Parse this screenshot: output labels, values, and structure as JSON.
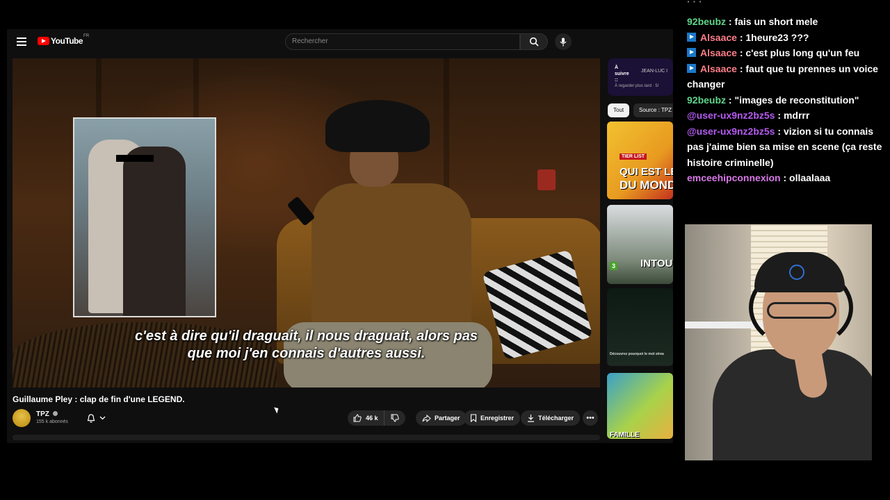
{
  "youtube": {
    "logo_text": "YouTube",
    "logo_region": "FR",
    "search_placeholder": "Rechercher",
    "video": {
      "subtitle": "c'est à dire qu'il draguait, il nous draguait, alors pas\nque moi j'en connais d'autres aussi."
    },
    "title": "Guillaume Pley : clap de fin d'une LEGEND.",
    "channel": {
      "name": "TPZ",
      "subscribers": "155 k abonnés"
    },
    "actions": {
      "likes": "46 k",
      "share": "Partager",
      "save": "Enregistrer",
      "download": "Télécharger"
    },
    "up_next": {
      "label": "À suivre ::",
      "title": "JEAN-LUC I",
      "subtitle": "À regarder plus tard · 5/"
    },
    "chips": [
      "Tout",
      "Source : TPZ"
    ],
    "thumbnails": [
      {
        "line1": "TIER LIST",
        "line2": "QUI EST LE MEI",
        "line3": "DU MONDE"
      },
      {
        "line1": "INTOU",
        "badge": "3"
      },
      {
        "line1": "Découvrez pourquoi le mot strea"
      },
      {
        "line1": "FAMILLE"
      }
    ]
  },
  "chat": {
    "messages": [
      {
        "user": "92beubz",
        "color": "#5fd68a",
        "badge": false,
        "text": "fais un short mele"
      },
      {
        "user": "Alsaace",
        "color": "#ff7f8a",
        "badge": true,
        "text": "1heure23 ???"
      },
      {
        "user": "Alsaace",
        "color": "#ff7f8a",
        "badge": true,
        "text": "c'est plus long qu'un feu"
      },
      {
        "user": "Alsaace",
        "color": "#ff7f8a",
        "badge": true,
        "text": "faut que tu prennes un voice changer"
      },
      {
        "user": "92beubz",
        "color": "#5fd68a",
        "badge": false,
        "text": "\"images de reconstitution\""
      },
      {
        "user": "@user-ux9nz2bz5s",
        "color": "#b45cf0",
        "badge": false,
        "text": "mdrrr"
      },
      {
        "user": "@user-ux9nz2bz5s",
        "color": "#b45cf0",
        "badge": false,
        "text": "vizion si tu connais pas j'aime bien sa mise en scene (ça reste histoire criminelle)"
      },
      {
        "user": "emceehipconnexion",
        "color": "#d77ae6",
        "badge": false,
        "text": "ollaalaaa"
      }
    ]
  }
}
